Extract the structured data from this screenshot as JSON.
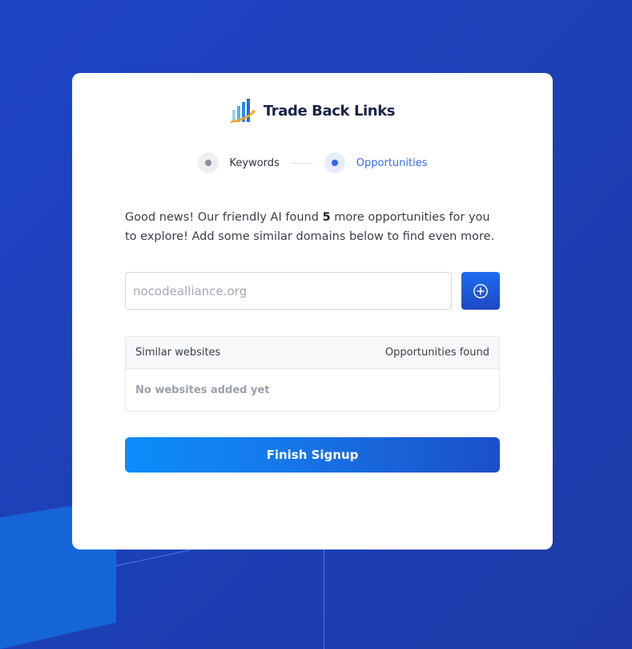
{
  "brand": {
    "name": "Trade Back Links",
    "icon": "bar-chart-growth-icon"
  },
  "steps": [
    {
      "label": "Keywords",
      "state": "done"
    },
    {
      "label": "Opportunities",
      "state": "active"
    }
  ],
  "intro": {
    "before": "Good news! Our friendly AI found ",
    "count": "5",
    "after": " more opportunities for you to explore! Add some similar domains below to find even more."
  },
  "domain_input": {
    "placeholder": "nocodealliance.org",
    "value": ""
  },
  "add_button": {
    "icon": "plus-circle-icon"
  },
  "table": {
    "columns": [
      "Similar websites",
      "Opportunities found"
    ],
    "empty_text": "No websites added yet"
  },
  "finish_button": {
    "label": "Finish Signup"
  },
  "colors": {
    "background": "#1f44c6",
    "accent": "#3366f0",
    "brand_text": "#1c2348",
    "button_gradient_start": "#0a8dfb",
    "button_gradient_end": "#1c4fc8"
  }
}
